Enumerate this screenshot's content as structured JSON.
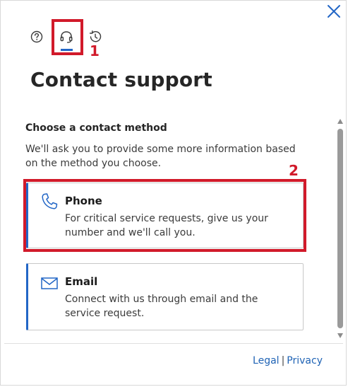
{
  "header": {
    "close_icon": "close-icon",
    "tabs": [
      {
        "name": "help",
        "icon": "question-circle-icon"
      },
      {
        "name": "contact-support",
        "icon": "headset-icon",
        "selected": true
      },
      {
        "name": "history",
        "icon": "history-icon"
      }
    ]
  },
  "annotations": {
    "label_1": "1",
    "label_2": "2",
    "color": "#d11a2a"
  },
  "main": {
    "title": "Contact support",
    "section_title": "Choose a contact method",
    "section_desc": "We'll ask you to provide some more information based on the method you choose.",
    "methods": [
      {
        "id": "phone",
        "icon": "phone-icon",
        "title": "Phone",
        "description": "For critical service requests, give us your number and we'll call you."
      },
      {
        "id": "email",
        "icon": "mail-icon",
        "title": "Email",
        "description": "Connect with us through email and the service request."
      }
    ]
  },
  "footer": {
    "legal": "Legal",
    "separator": "|",
    "privacy": "Privacy"
  },
  "colors": {
    "accent": "#2266c6",
    "link": "#1f63b5",
    "annotation": "#d11a2a"
  }
}
